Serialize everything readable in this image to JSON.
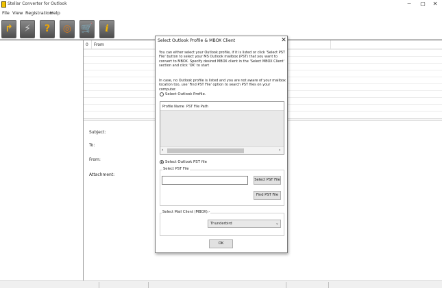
{
  "window": {
    "title": "Stellar Converter for Outlook",
    "min_glyph": "−",
    "max_glyph": "▢",
    "close_glyph": "✕"
  },
  "menu": [
    "File",
    "View",
    "Registration",
    "Help"
  ],
  "toolbar": {
    "items": [
      {
        "name": "open-folder-icon",
        "glyph": "↱"
      },
      {
        "name": "convert-icon",
        "glyph": "⚡"
      },
      {
        "name": "help-icon",
        "glyph": "?"
      },
      {
        "name": "globe-icon",
        "glyph": "◎"
      },
      {
        "name": "cart-icon",
        "glyph": "🛒"
      },
      {
        "name": "info-icon",
        "glyph": "i"
      }
    ]
  },
  "list": {
    "attach_glyph": "0",
    "from_label": "From"
  },
  "preview": {
    "subject_label": "Subject:",
    "to_label": "To:",
    "from_label": "From:",
    "attachment_label": "Attachment:"
  },
  "dialog": {
    "title": "Select Outlook Profile & MBOX Client",
    "close_glyph": "✕",
    "description_1": "You can either select your Outlook profile, if it is listed or click 'Select PST File' button to select your MS Outlook mailbox (PST) that you want to convert to MBOX. Specify desired MBOX client in the 'Select MBOX Client' section and click 'OK' to start",
    "description_2": "In case, no Outlook profile is listed and you are not aware of your mailbox location too, use 'Find PST File' option to search PST files on your computer.",
    "radio_profile_label": "Select Outlook Profile.",
    "radio_profile_checked": false,
    "table": {
      "col_profile": "Profile Name",
      "col_path": "PST File Path",
      "scroll_left": "‹",
      "scroll_right": "›"
    },
    "radio_pst_label": "Select Outlook PST file",
    "radio_pst_checked": true,
    "pst_group_label": "Select PST File",
    "pst_input_value": "",
    "select_pst_button": "Select PST File",
    "find_pst_button": "Find PST File",
    "mail_group_label": "Select Mail Client (MBOX):-",
    "mail_client_value": "Thunderbird",
    "dropdown_arrow": "⌄",
    "ok_button": "OK"
  }
}
